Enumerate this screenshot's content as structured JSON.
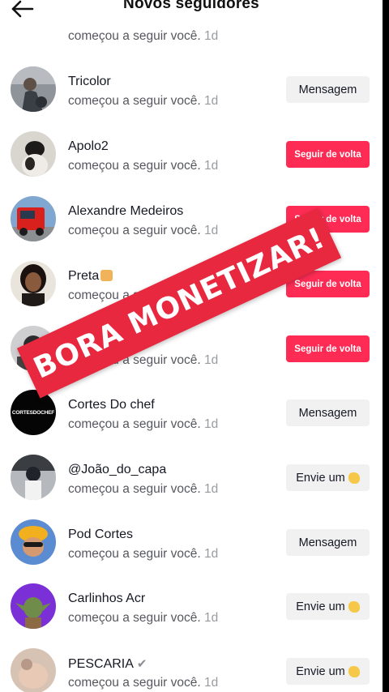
{
  "header": {
    "title": "Novos seguidores",
    "back_icon": "arrow-left-icon"
  },
  "banner": {
    "text": "BORA MONETIZAR!",
    "color": "#e8283f"
  },
  "accent": "#fe2c55",
  "rows": [
    {
      "name": "",
      "action": "começou a seguir você.",
      "time": "1d",
      "button": "",
      "button_style": "red"
    },
    {
      "name": "Tricolor",
      "action": "começou a seguir você.",
      "time": "1d",
      "button": "Mensagem",
      "button_style": "grey"
    },
    {
      "name": "Apolo2",
      "action": "começou a seguir você.",
      "time": "1d",
      "button": "Seguir de volta",
      "button_style": "red"
    },
    {
      "name": "Alexandre Medeiros",
      "action": "começou a seguir você.",
      "time": "1d",
      "button": "Seguir de volta",
      "button_style": "red"
    },
    {
      "name": "Preta",
      "action": "começou a seguir você.",
      "time": "1d",
      "button": "Seguir de volta",
      "button_style": "red"
    },
    {
      "name": "",
      "action": "começou a seguir você.",
      "time": "1d",
      "button": "Seguir de volta",
      "button_style": "red"
    },
    {
      "name": "Cortes Do chef",
      "action": "começou a seguir você.",
      "time": "1d",
      "button": "Mensagem",
      "button_style": "grey"
    },
    {
      "name": "@João_do_capa",
      "action": "começou a seguir você.",
      "time": "1d",
      "button": "Envie um",
      "button_style": "grey"
    },
    {
      "name": "Pod Cortes",
      "action": "começou a seguir você.",
      "time": "1d",
      "button": "Mensagem",
      "button_style": "grey"
    },
    {
      "name": "Carlinhos Acr",
      "action": "começou a seguir você.",
      "time": "1d",
      "button": "Envie um",
      "button_style": "grey"
    },
    {
      "name": "PESCARIA",
      "action": "começou a seguir você.",
      "time": "1d",
      "button": "Envie um",
      "button_style": "grey"
    }
  ],
  "avatar_text": {
    "cortes_do_chef": "CORTESDOCHEF"
  }
}
